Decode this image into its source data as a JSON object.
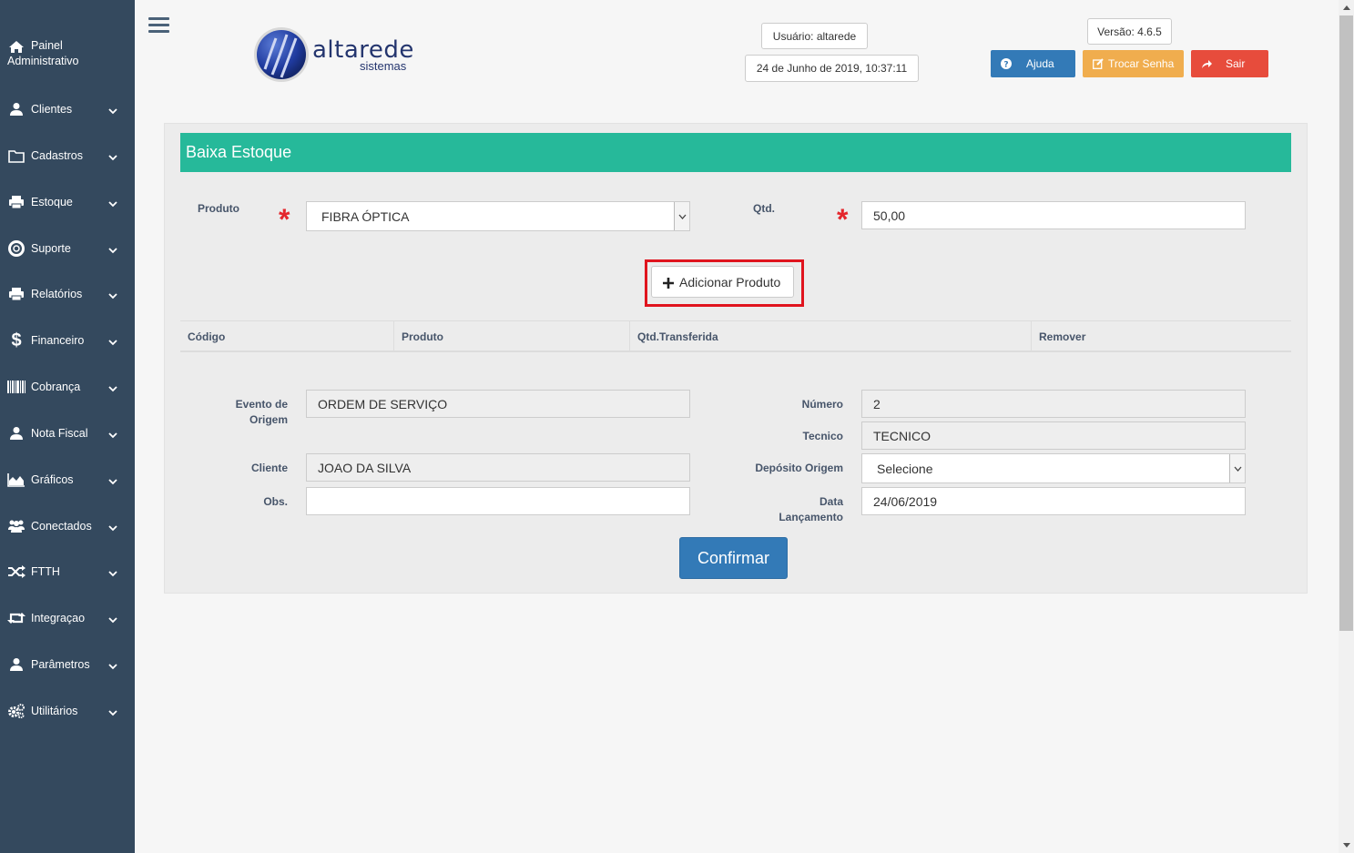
{
  "sidebar": {
    "painel": {
      "line1": "Painel",
      "line2": "Administrativo",
      "icon": "home-icon"
    },
    "items": [
      {
        "label": "Clientes",
        "icon": "user-icon"
      },
      {
        "label": "Cadastros",
        "icon": "folder-icon"
      },
      {
        "label": "Estoque",
        "icon": "printer-icon"
      },
      {
        "label": "Suporte",
        "icon": "lifebuoy-icon"
      },
      {
        "label": "Relatórios",
        "icon": "printer-icon"
      },
      {
        "label": "Financeiro",
        "icon": "dollar-icon"
      },
      {
        "label": "Cobrança",
        "icon": "barcode-icon"
      },
      {
        "label": "Nota Fiscal",
        "icon": "user-icon"
      },
      {
        "label": "Gráficos",
        "icon": "area-chart-icon"
      },
      {
        "label": "Conectados",
        "icon": "users-icon"
      },
      {
        "label": "FTTH",
        "icon": "random-icon"
      },
      {
        "label": "Integraçao",
        "icon": "retweet-icon"
      },
      {
        "label": "Parâmetros",
        "icon": "user-icon"
      },
      {
        "label": "Utilitários",
        "icon": "cogs-icon"
      }
    ]
  },
  "header": {
    "logo_main": "altarede",
    "logo_sub": "sistemas",
    "user": "Usuário: altarede",
    "datetime": "24 de Junho de 2019, 10:37:11",
    "version": "Versão: 4.6.5",
    "help": "Ajuda",
    "change_password": "Trocar Senha",
    "logout": "Sair"
  },
  "colors": {
    "sidebar": "#34495e",
    "header_bar": "#26b99a",
    "help_button": "#337ab7",
    "password_button": "#f0ad4e",
    "logout_button": "#e74c3c",
    "required": "#e4262c"
  },
  "form": {
    "title": "Baixa Estoque",
    "produto_label": "Produto",
    "produto_value": "FIBRA ÓPTICA",
    "qtd_label": "Qtd.",
    "qtd_value": "50,00",
    "required_mark": "*",
    "add_button": "Adicionar Produto",
    "table_headers": [
      "Código",
      "Produto",
      "Qtd.Transferida",
      "Remover"
    ],
    "evento_label_1": "Evento de",
    "evento_label_2": "Origem",
    "evento_value": "ORDEM DE SERVIÇO",
    "numero_label": "Número",
    "numero_value": "2",
    "tecnico_label": "Tecnico",
    "tecnico_value": "TECNICO",
    "cliente_label": "Cliente",
    "cliente_value": "JOAO DA SILVA",
    "deposito_label": "Depósito Origem",
    "deposito_value": "Selecione",
    "obs_label": "Obs.",
    "obs_value": "",
    "data_label_1": "Data",
    "data_label_2": "Lançamento",
    "data_value": "24/06/2019",
    "confirm_button": "Confirmar"
  }
}
